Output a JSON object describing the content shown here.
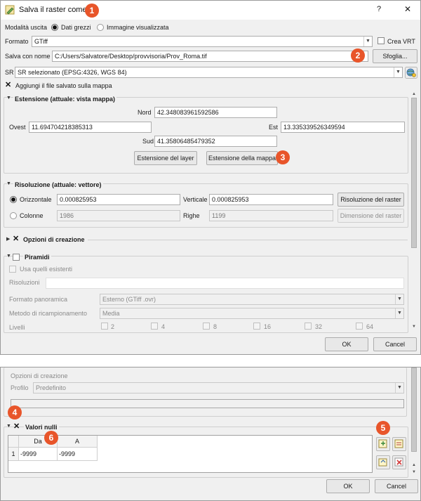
{
  "dialog": {
    "title": "Salva il raster come...",
    "help_label": "?",
    "close_label": "✕"
  },
  "output_mode": {
    "label": "Modalità uscita",
    "raw_label": "Dati grezzi",
    "rendered_label": "Immagine visualizzata"
  },
  "format": {
    "label": "Formato",
    "value": "GTiff",
    "vrt_label": "Crea VRT"
  },
  "save_as": {
    "label": "Salva con nome",
    "value": "C:/Users/Salvatore/Desktop/provvisoria/Prov_Roma.tif",
    "browse_label": "Sfoglia..."
  },
  "crs": {
    "label": "SR",
    "value": "SR selezionato (EPSG:4326, WGS 84)"
  },
  "add_to_map": {
    "label": "Aggiungi il file salvato sulla mappa"
  },
  "extent": {
    "title": "Estensione (attuale: vista mappa)",
    "north_label": "Nord",
    "north_value": "42.348083961592586",
    "west_label": "Ovest",
    "west_value": "11.694704218385313",
    "east_label": "Est",
    "east_value": "13.335339526349594",
    "south_label": "Sud",
    "south_value": "41.35806485479352",
    "layer_button": "Estensione del layer",
    "map_button": "Estensione della mappa"
  },
  "resolution": {
    "title": "Risoluzione (attuale: vettore)",
    "horizontal_label": "Orizzontale",
    "horizontal_value": "0.000825953",
    "vertical_label": "Verticale",
    "vertical_value": "0.000825953",
    "raster_res_button": "Risoluzione del raster",
    "columns_label": "Colonne",
    "columns_value": "1986",
    "rows_label": "Righe",
    "rows_value": "1199",
    "raster_size_button": "Dimensione del raster"
  },
  "creation_options": {
    "title": "Opzioni di creazione"
  },
  "pyramids": {
    "title": "Piramidi",
    "use_existing": "Usa quelli esistenti",
    "resolutions_label": "Risoluzioni",
    "overview_format_label": "Formato panoramica",
    "overview_format_value": "Esterno (GTiff .ovr)",
    "resampling_label": "Metodo di ricampionamento",
    "resampling_value": "Media",
    "levels_label": "Livelli",
    "levels": [
      "2",
      "4",
      "8",
      "16",
      "32",
      "64"
    ]
  },
  "buttons": {
    "ok": "OK",
    "cancel": "Cancel"
  },
  "lower": {
    "creation_options_label": "Opzioni di creazione",
    "profile_label": "Profilo",
    "profile_value": "Predefinito",
    "nodata_title": "Valori nulli",
    "table_headers": [
      "Da",
      "A"
    ],
    "rows": [
      {
        "index": "1",
        "from": "-9999",
        "to": "-9999"
      }
    ]
  },
  "badges": [
    "1",
    "2",
    "3",
    "4",
    "5",
    "6"
  ],
  "colors": {
    "badge": "#e8552a",
    "dialog_bg": "#f0f0f0"
  },
  "icons": {
    "title": "pencil-raster-icon",
    "crs": "globe-crs-icon",
    "add_row": "add-row-icon",
    "load": "load-icon",
    "add_current": "add-current-icon",
    "remove": "remove-icon"
  }
}
